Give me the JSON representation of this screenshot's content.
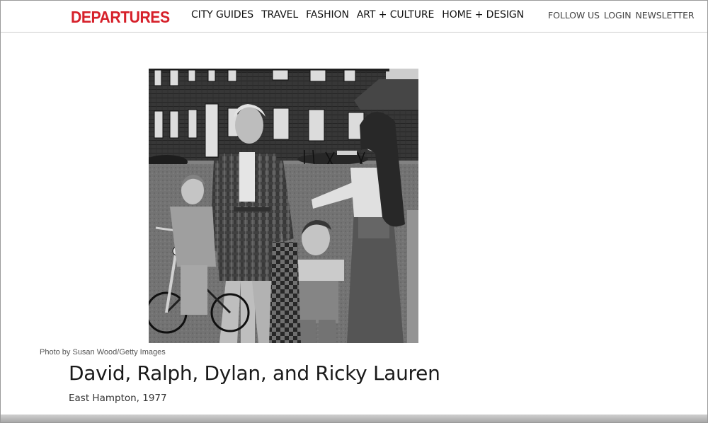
{
  "header": {
    "logo": "DEPARTURES",
    "nav": [
      "CITY GUIDES",
      "TRAVEL",
      "FASHION",
      "ART + CULTURE",
      "HOME + DESIGN"
    ],
    "utility": [
      "FOLLOW US",
      "LOGIN",
      "NEWSLETTER"
    ]
  },
  "article": {
    "photo_credit": "Photo by Susan Wood/Getty Images",
    "title": "David, Ralph, Dylan, and Ricky Lauren",
    "subtitle": "East Hampton, 1977"
  },
  "colors": {
    "brand": "#d6202a",
    "text": "#1a1a1a",
    "divider": "#cfcfcf"
  }
}
